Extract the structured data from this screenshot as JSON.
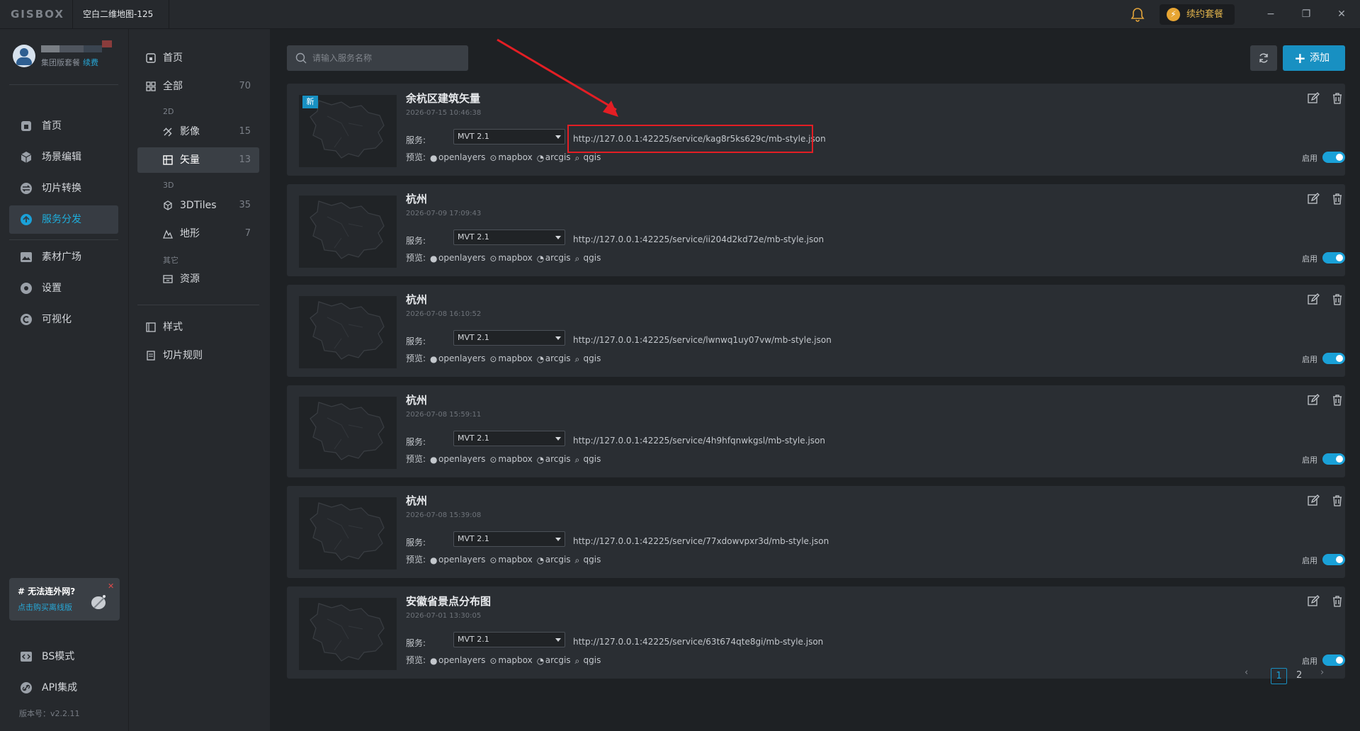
{
  "titlebar": {
    "logo": "GISBOX",
    "tab_title": "空白二维地图-125",
    "renew_label": "续约套餐",
    "minimize": "−",
    "restore": "❐",
    "close": "✕"
  },
  "user": {
    "plan": "集团版套餐",
    "renew_link": "续费"
  },
  "nav": {
    "items": [
      {
        "label": "首页",
        "icon": "home-icon"
      },
      {
        "label": "场景编辑",
        "icon": "cube-icon"
      },
      {
        "label": "切片转换",
        "icon": "convert-icon"
      },
      {
        "label": "服务分发",
        "icon": "upload-icon",
        "active": true
      },
      {
        "label": "素材广场",
        "icon": "image-icon"
      },
      {
        "label": "设置",
        "icon": "gear-icon"
      },
      {
        "label": "可视化",
        "icon": "chart-icon"
      },
      {
        "label": "BS模式",
        "icon": "code-icon"
      },
      {
        "label": "API集成",
        "icon": "link-icon"
      }
    ]
  },
  "promo": {
    "title": "# 无法连外网?",
    "link": "点击购买离线版"
  },
  "version": "版本号：v2.2.11",
  "subnav": {
    "home": "首页",
    "all": {
      "label": "全部",
      "count": "70"
    },
    "group_2d": "2D",
    "imagery": {
      "label": "影像",
      "count": "15"
    },
    "vector": {
      "label": "矢量",
      "count": "13"
    },
    "group_3d": "3D",
    "tiles3d": {
      "label": "3DTiles",
      "count": "35"
    },
    "terrain": {
      "label": "地形",
      "count": "7"
    },
    "group_other": "其它",
    "resource": "资源",
    "style": "样式",
    "tile_rules": "切片规则"
  },
  "toolbar": {
    "search_placeholder": "请输入服务名称",
    "add_label": "添加"
  },
  "labels": {
    "service": "服务:",
    "preview": "预览:",
    "enable": "启用",
    "new_badge": "新",
    "preview_options": [
      "openlayers",
      "mapbox",
      "arcgis",
      "qgis"
    ]
  },
  "services": [
    {
      "name": "余杭区建筑矢量",
      "date": "2026-07-15 10:46:38",
      "version": "MVT 2.1",
      "url": "http://127.0.0.1:42225/service/kag8r5ks629c/mb-style.json",
      "enabled": true,
      "is_new": true
    },
    {
      "name": "杭州",
      "date": "2026-07-09 17:09:43",
      "version": "MVT 2.1",
      "url": "http://127.0.0.1:42225/service/ii204d2kd72e/mb-style.json",
      "enabled": true
    },
    {
      "name": "杭州",
      "date": "2026-07-08 16:10:52",
      "version": "MVT 2.1",
      "url": "http://127.0.0.1:42225/service/lwnwq1uy07vw/mb-style.json",
      "enabled": true
    },
    {
      "name": "杭州",
      "date": "2026-07-08 15:59:11",
      "version": "MVT 2.1",
      "url": "http://127.0.0.1:42225/service/4h9hfqnwkgsl/mb-style.json",
      "enabled": true
    },
    {
      "name": "杭州",
      "date": "2026-07-08 15:39:08",
      "version": "MVT 2.1",
      "url": "http://127.0.0.1:42225/service/77xdowvpxr3d/mb-style.json",
      "enabled": true
    },
    {
      "name": "安徽省景点分布图",
      "date": "2026-07-01 13:30:05",
      "version": "MVT 2.1",
      "url": "http://127.0.0.1:42225/service/63t674qte8gi/mb-style.json",
      "enabled": true
    }
  ],
  "pagination": {
    "prev": "‹",
    "pages": [
      "1",
      "2"
    ],
    "current": "1",
    "next": "›"
  },
  "colors": {
    "accent": "#1aa1d8",
    "highlight": "#e31e24",
    "renew": "#e0b34c"
  }
}
